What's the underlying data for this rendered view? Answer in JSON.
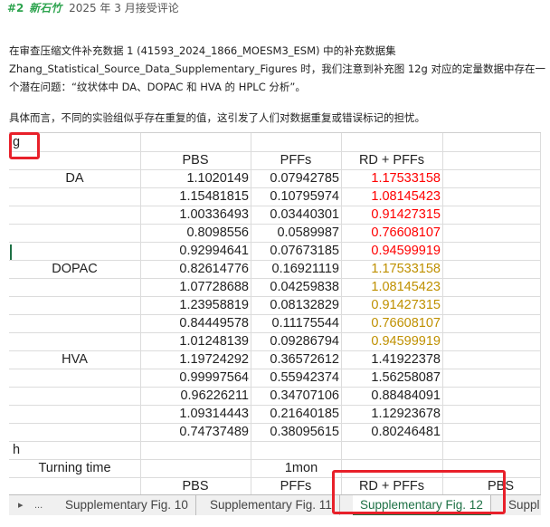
{
  "header": {
    "hash": "#2",
    "author": "新石竹",
    "rest": "2025 年 3 月接受评论"
  },
  "paragraphs": [
    "在审查压缩文件补充数据 1 (41593_2024_1866_MOESM3_ESM) 中的补充数据集",
    "Zhang_Statistical_Source_Data_Supplementary_Figures 时，我们注意到补充图 12g 对应的定量数据中存在一",
    "个潜在问题：“纹状体中 DA、DOPAC 和 HVA 的 HPLC 分析”。",
    "具体而言，不同的实验组似乎存在重复的值，这引发了人们对数据重复或错误标记的担忧。"
  ],
  "sheet": {
    "section_g": "g",
    "columns": [
      "PBS",
      "PFFs",
      "RD + PFFs"
    ],
    "groups": [
      {
        "label": "DA",
        "color": "red",
        "rows": [
          [
            "1.1020149",
            "0.07942785",
            "1.17533158"
          ],
          [
            "1.15481815",
            "0.10795974",
            "1.08145423"
          ],
          [
            "1.00336493",
            "0.03440301",
            "0.91427315"
          ],
          [
            "0.8098556",
            "0.0589987",
            "0.76608107"
          ],
          [
            "0.92994641",
            "0.07673185",
            "0.94599919"
          ]
        ]
      },
      {
        "label": "DOPAC",
        "color": "gold",
        "rows": [
          [
            "0.82614776",
            "0.16921119",
            "1.17533158"
          ],
          [
            "1.07728688",
            "0.04259838",
            "1.08145423"
          ],
          [
            "1.23958819",
            "0.08132829",
            "0.91427315"
          ],
          [
            "0.84449578",
            "0.11175544",
            "0.76608107"
          ],
          [
            "1.01248139",
            "0.09286794",
            "0.94599919"
          ]
        ]
      },
      {
        "label": "HVA",
        "color": "plain",
        "rows": [
          [
            "1.19724292",
            "0.36572612",
            "1.41922378"
          ],
          [
            "0.99997564",
            "0.55942374",
            "1.56258087"
          ],
          [
            "0.96226211",
            "0.34707106",
            "0.88484091"
          ],
          [
            "1.09314443",
            "0.21640185",
            "1.12923678"
          ],
          [
            "0.74737489",
            "0.38095615",
            "0.80246481"
          ]
        ]
      }
    ],
    "section_h": "h",
    "turning_time_label": "Turning time",
    "turning_time_value": "1mon",
    "h_columns": [
      "PBS",
      "PFFs",
      "RD + PFFs",
      "PBS"
    ]
  },
  "tabs": {
    "nav_next": "▸",
    "nav_more": "...",
    "items": [
      "Supplementary Fig. 10",
      "Supplementary Fig. 11",
      "Supplementary Fig. 12",
      "Suppl"
    ],
    "active_index": 2
  },
  "colors": {
    "red": "#ff0000",
    "gold": "#bf9000",
    "highlight": "#e8202a",
    "active_tab": "#1e7145"
  }
}
